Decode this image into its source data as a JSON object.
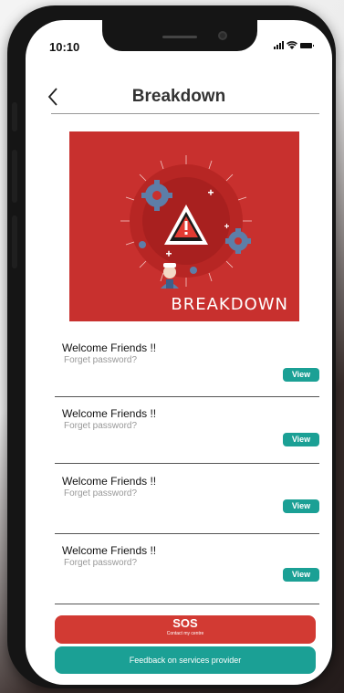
{
  "status_bar": {
    "time": "10:10"
  },
  "header": {
    "title": "Breakdown"
  },
  "banner": {
    "text": "BREAKDOWN"
  },
  "list": [
    {
      "title": "Welcome Friends !!",
      "subtitle": "Forget password?",
      "action": "View"
    },
    {
      "title": "Welcome Friends !!",
      "subtitle": "Forget password?",
      "action": "View"
    },
    {
      "title": "Welcome Friends !!",
      "subtitle": "Forget password?",
      "action": "View"
    },
    {
      "title": "Welcome Friends !!",
      "subtitle": "Forget password?",
      "action": "View"
    }
  ],
  "sos": {
    "label": "SOS",
    "sub": "Contact my centre"
  },
  "feedback": {
    "label": "Feedback on services provider"
  },
  "colors": {
    "banner_red": "#c8302e",
    "teal": "#1ba095",
    "sos_red": "#d23a33"
  }
}
